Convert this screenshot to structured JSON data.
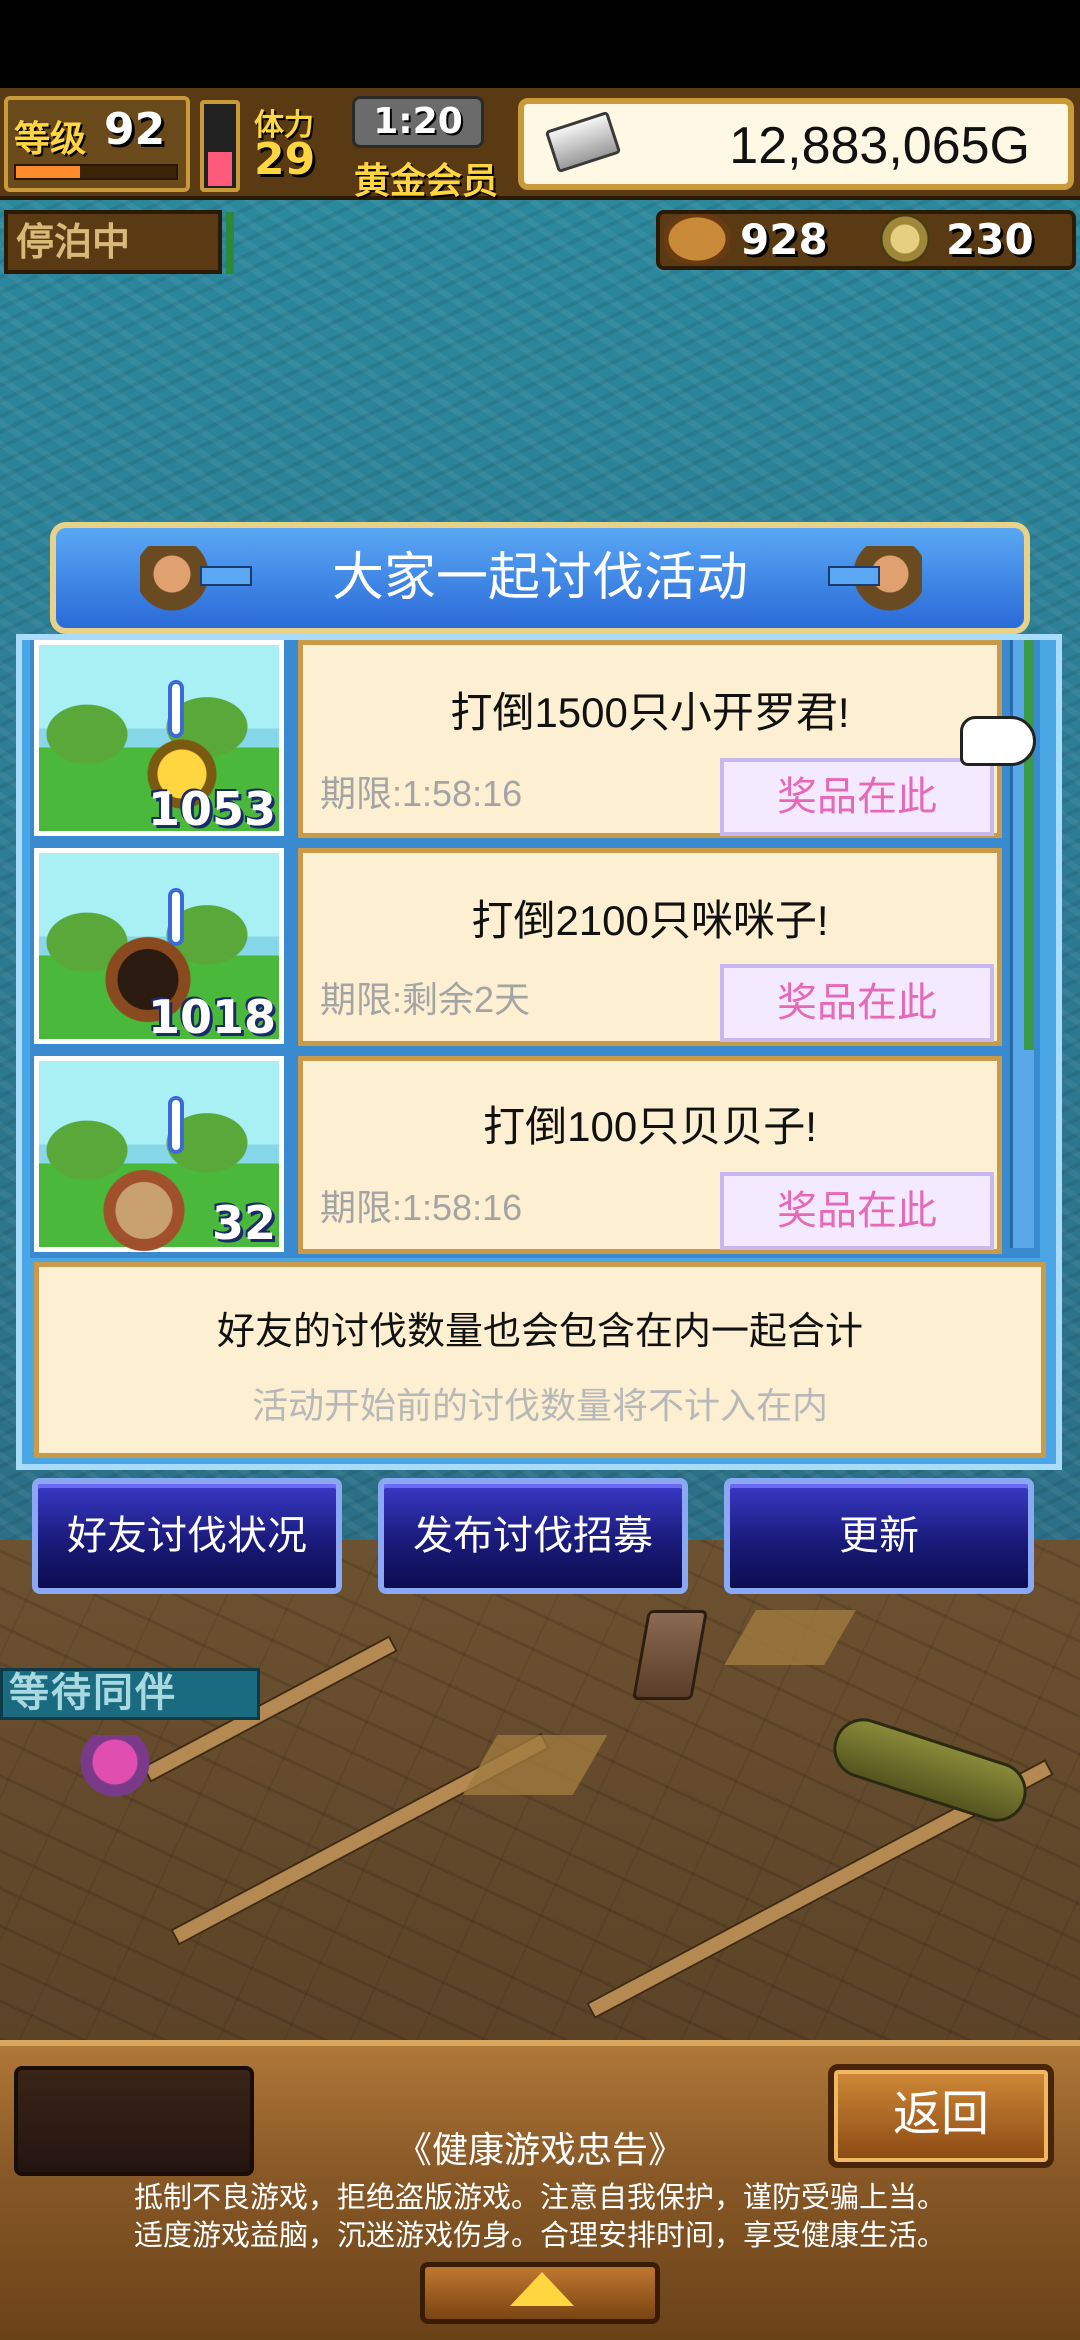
{
  "hud": {
    "level_label": "等级",
    "level": "92",
    "level_progress": 0.4,
    "stamina_label": "体力",
    "stamina": "29",
    "timer": "1:20",
    "member": "黄金会员",
    "gold": "12,883,065G",
    "dock_status": "停泊中",
    "bread": "928",
    "coins": "230"
  },
  "dialog": {
    "title": "大家一起讨伐活动",
    "missions": [
      {
        "count": "1053",
        "title": "打倒1500只小开罗君!",
        "deadline": "期限:1:58:16",
        "reward": "奖品在此"
      },
      {
        "count": "1018",
        "title": "打倒2100只咪咪子!",
        "deadline": "期限:剩余2天",
        "reward": "奖品在此"
      },
      {
        "count": "32",
        "title": "打倒100只贝贝子!",
        "deadline": "期限:1:58:16",
        "reward": "奖品在此"
      }
    ],
    "note_main": "好友的讨伐数量也会包含在内一起合计",
    "note_sub": "活动开始前的讨伐数量将不计入在内",
    "buttons": {
      "friends": "好友讨伐状况",
      "recruit": "发布讨伐招募",
      "refresh": "更新"
    }
  },
  "scene": {
    "waiting": "等待同伴"
  },
  "bottom": {
    "back": "返回",
    "health_title": "《健康游戏忠告》",
    "health_line1": "抵制不良游戏，拒绝盗版游戏。注意自我保护，谨防受骗上当。",
    "health_line2": "适度游戏益脑，沉迷游戏伤身。合理安排时间，享受健康生活。"
  },
  "colors": {
    "dialog_blue": "#2a6ad8",
    "reward_text": "#e868b8",
    "button_navy": "#1a1a7a"
  },
  "icons": {
    "gold": "silver-bar-icon",
    "bread": "bread-icon",
    "coin": "coin-icon",
    "expand": "triangle-up-icon"
  }
}
